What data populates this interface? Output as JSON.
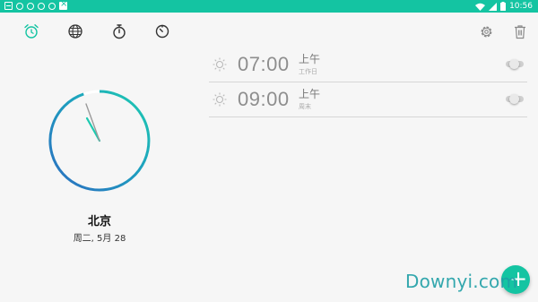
{
  "status_bar": {
    "time": "10:56",
    "accent": "#14c4a2",
    "notification_icons": [
      "image-notification-icon",
      "android-debug-icon",
      "android-debug-icon",
      "android-debug-icon",
      "android-debug-icon",
      "app-notification-icon"
    ],
    "right_icons": [
      "wifi-icon",
      "signal-icon",
      "battery-icon"
    ]
  },
  "tabs": [
    {
      "name": "tab-alarm",
      "icon": "alarm-clock-icon",
      "active": true
    },
    {
      "name": "tab-world-clock",
      "icon": "globe-icon",
      "active": false
    },
    {
      "name": "tab-stopwatch",
      "icon": "stopwatch-icon",
      "active": false
    },
    {
      "name": "tab-timer",
      "icon": "timer-icon",
      "active": false
    }
  ],
  "toolbar": {
    "settings_icon": "gear-icon",
    "delete_icon": "trash-icon"
  },
  "clock": {
    "city": "北京",
    "date": "周二, 5月 28",
    "arc_colors": [
      "#1ecdb0",
      "#2a6fbf"
    ]
  },
  "alarms": [
    {
      "time": "07:00",
      "ampm": "上午",
      "repeat": "工作日",
      "enabled": false,
      "icon": "sun-icon"
    },
    {
      "time": "09:00",
      "ampm": "上午",
      "repeat": "周末",
      "enabled": false,
      "icon": "sun-icon"
    }
  ],
  "fab": {
    "icon": "plus-icon",
    "label": "+"
  },
  "watermark": "Downyi.com"
}
